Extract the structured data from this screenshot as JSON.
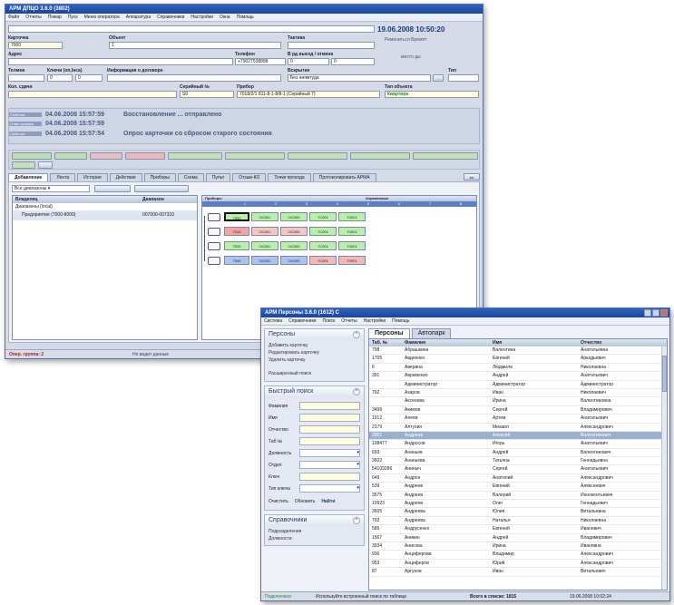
{
  "w1": {
    "title": "АРМ ДПЦО 3.6.0 (3802)",
    "menu": [
      "Файл",
      "Отчеты",
      "Пожар",
      "Пуск",
      "Меню оператора",
      "Аппаратура",
      "Справочники",
      "Настройки",
      "Окна",
      "Помощь"
    ],
    "datetime": "19.06.2008 10:50:20",
    "caption1": "Ремениться Времят",
    "caption2": "место ды",
    "card_label": "Карточка",
    "card_value": "7000",
    "object_label": "Объект",
    "object_value": "1",
    "phone_label": "Телефон",
    "phone_value": "+79027538888",
    "address_label": "Адрес",
    "tactics_label": "Тактика",
    "wid_label": "В рд выезд / отмена",
    "wid_v1": "0",
    "wid_v2": "0",
    "key_label": "Ключи (оп,Інса)",
    "key_v1": "0",
    "key_v2": "0",
    "contract_label": "Информация о договоре",
    "opening_label": "Вскрытие",
    "opening_value": "Без ниямтуда",
    "type_label": "Тип",
    "serial_label": "Серийный №",
    "serial_value": "S0",
    "device_label": "Прибор",
    "device_value": "7018/2/1 811-8-1-8/8-1 (Серийный 7)",
    "objtype_label": "Тип объекта",
    "objtype_value": "Квартира",
    "events": [
      {
        "kind": "Событие",
        "time": "04.06.2008 15:57:59",
        "text": "Восстановление ... отправлено"
      },
      {
        "kind": "Ответ приема",
        "time": "04.06.2008 15:57:59",
        "text": ""
      },
      {
        "kind": "Событие",
        "time": "04.06.2008 15:57:54",
        "text": "Опрос карточки со сбросом старого состояния"
      }
    ],
    "tabs": [
      "Добавление",
      "Лента",
      "Истории",
      "Действия",
      "Приборы",
      "Схема",
      "Пульт",
      "Отзыв-КО",
      "Точки прохода",
      "Протоколировать АРМА"
    ],
    "filter_value": "Все диапазоны",
    "tree_headers": [
      "Владелец",
      "Диапазон"
    ],
    "tree": [
      {
        "name": "Диапазоны (local)",
        "range": ""
      },
      {
        "name": "Предприятие (7000-8000)",
        "range": "007000-007310"
      }
    ],
    "grid_header": "Приборы",
    "grid_header2": "Охраняемые",
    "cols": [
      "1",
      "2",
      "3",
      "4",
      "5",
      "6",
      "7",
      "8"
    ],
    "devices": [
      {
        "id": "7000",
        "c": [
          "OC001",
          "OC000",
          "7C001",
          "T0001"
        ],
        "st": "green"
      },
      {
        "id": "7010",
        "c": [
          "OC001",
          "OC000",
          "7C001",
          "T0001"
        ],
        "st": "red"
      },
      {
        "id": "7020",
        "c": [
          "OC001",
          "OC000",
          "7C001",
          "T0001"
        ],
        "st": "green"
      },
      {
        "id": "7040",
        "c": [
          "OC001",
          "OC000",
          "7C001",
          "T0001"
        ],
        "st": "blue"
      }
    ],
    "status_left": "Опер. группа: 2",
    "status_mid": "Не видит данные"
  },
  "w2": {
    "title": "АРМ Персоны 3.6.0 (1612) С",
    "menu": [
      "Система",
      "Справочники",
      "Поиск",
      "Отчеты",
      "Настройки",
      "Помощь"
    ],
    "panel1": {
      "title": "Персоны",
      "links": [
        "Добавить карточку",
        "Редактировать карточку",
        "Удалить карточку",
        "Расширенный поиск"
      ]
    },
    "panel2": {
      "title": "Быстрый поиск",
      "fields": [
        "Фамилия",
        "Имя",
        "Отчество",
        "Таб №",
        "Должность",
        "Отдел",
        "Ключ",
        "Тип ключа"
      ],
      "actions": [
        "Очистить",
        "Обновить",
        "Найти"
      ]
    },
    "panel3": {
      "title": "Справочники",
      "links": [
        "Подразделения",
        "Должности"
      ]
    },
    "tabs": [
      "Персоны",
      "Автопарк"
    ],
    "headers": [
      "Таб. №",
      "Фамилия",
      "Имя",
      "Отчество"
    ],
    "rows": [
      [
        "798",
        "Абрашкина",
        "Валентина",
        "Анатольевна"
      ],
      [
        "1705",
        "Авдеенко",
        "Евгений",
        "Аркадьевич"
      ],
      [
        "6",
        "Аверина",
        "Людмила",
        "Николаевна"
      ],
      [
        "391",
        "Авраменко",
        "Андрей",
        "Анатольевич"
      ],
      [
        "",
        "Администратор",
        "Администратор",
        "Администратор"
      ],
      [
        "792",
        "Азаров",
        "Иван",
        "Николаевич"
      ],
      [
        "",
        "Аксенова",
        "Ирина",
        "Валентиновна"
      ],
      [
        "3498",
        "Акимов",
        "Сергей",
        "Владимирович"
      ],
      [
        "1912",
        "Алеев",
        "Артем",
        "Анатольевич"
      ],
      [
        "2179",
        "Алтухин",
        "Михаил",
        "Александрович"
      ],
      [
        "3951",
        "Андреев",
        "Алексей",
        "Валентинович"
      ],
      [
        "108477",
        "Андросов",
        "Игорь",
        "Анатольевич"
      ],
      [
        "693",
        "Ананьев",
        "Андрей",
        "Валентинович"
      ],
      [
        "3602",
        "Ананьева",
        "Татьяна",
        "Геннадьевна"
      ],
      [
        "54109286",
        "Аниныч",
        "Сергей",
        "Анатольевич"
      ],
      [
        "649",
        "Андрон",
        "Анатолий",
        "Александрович"
      ],
      [
        "539",
        "Андреев",
        "Евгений",
        "Алексеевич"
      ],
      [
        "3575",
        "Андреев",
        "Валерий",
        "Иннокентьевич"
      ],
      [
        "10923",
        "Андреев",
        "Олег",
        "Геннадьевич"
      ],
      [
        "3605",
        "Андреева",
        "Юлия",
        "Витальевна"
      ],
      [
        "793",
        "Андреева",
        "Наталья",
        "Николаевна"
      ],
      [
        "585",
        "Андрусенко",
        "Евгений",
        "Иванович"
      ],
      [
        "1567",
        "Аникин",
        "Андрей",
        "Владимирович"
      ],
      [
        "3934",
        "Анисова",
        "Ирина",
        "Ивановна"
      ],
      [
        "936",
        "Анциферова",
        "Владимир",
        "Александрович"
      ],
      [
        "953",
        "Анциферов",
        "Юрий",
        "Александрович"
      ],
      [
        "87",
        "Аргунов",
        "Иван",
        "Витальевич"
      ]
    ],
    "selected_index": 10,
    "status_left": "Подключено",
    "status_mid": "Используйте встроенный поиск по таблице",
    "status_count": "Всего в списке: 1815",
    "status_time": "19.06.2008 10:02:24"
  }
}
